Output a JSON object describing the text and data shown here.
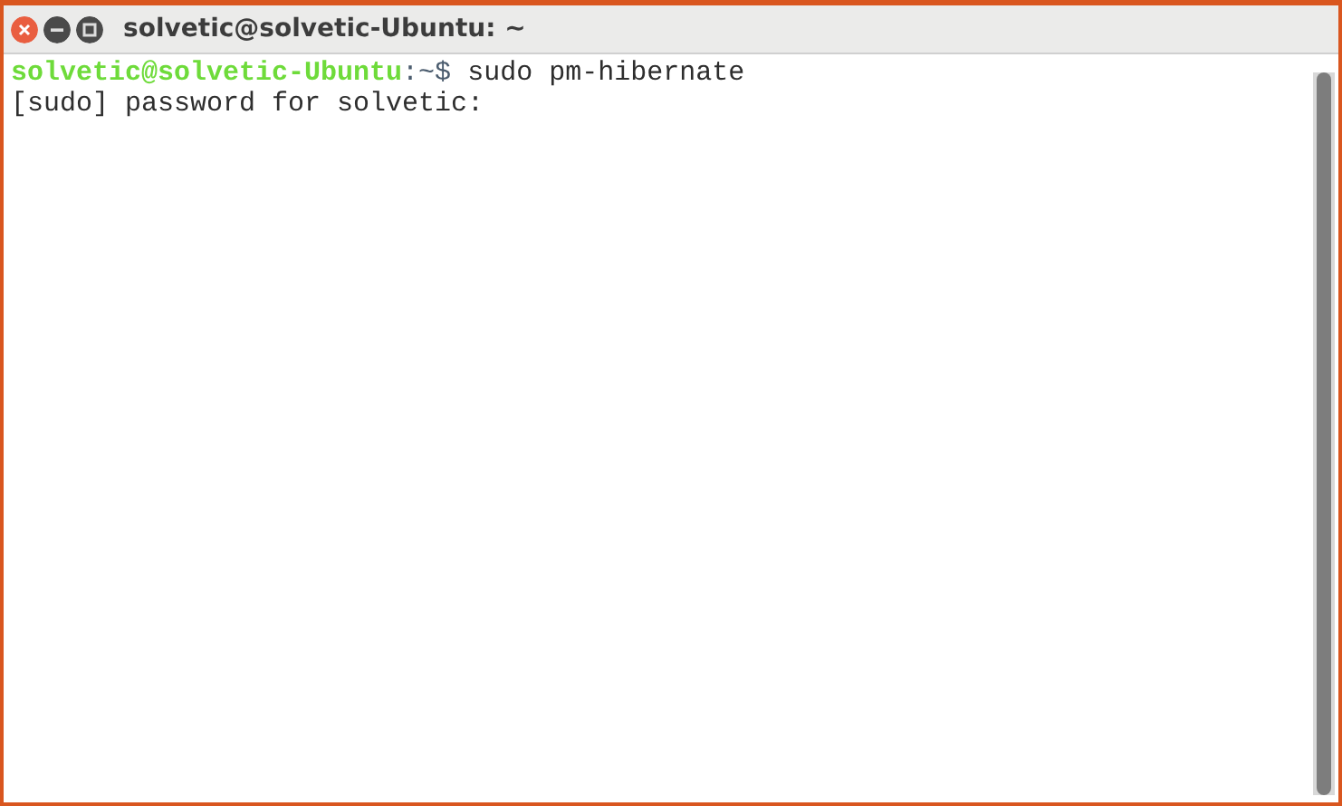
{
  "window": {
    "title": "solvetic@solvetic-Ubuntu: ~"
  },
  "terminal": {
    "lines": [
      {
        "kind": "prompt",
        "user_host": "solvetic@solvetic-Ubuntu",
        "path": ":~$",
        "command": "sudo pm-hibernate"
      },
      {
        "kind": "output",
        "text": "[sudo] password for solvetic:"
      }
    ]
  }
}
